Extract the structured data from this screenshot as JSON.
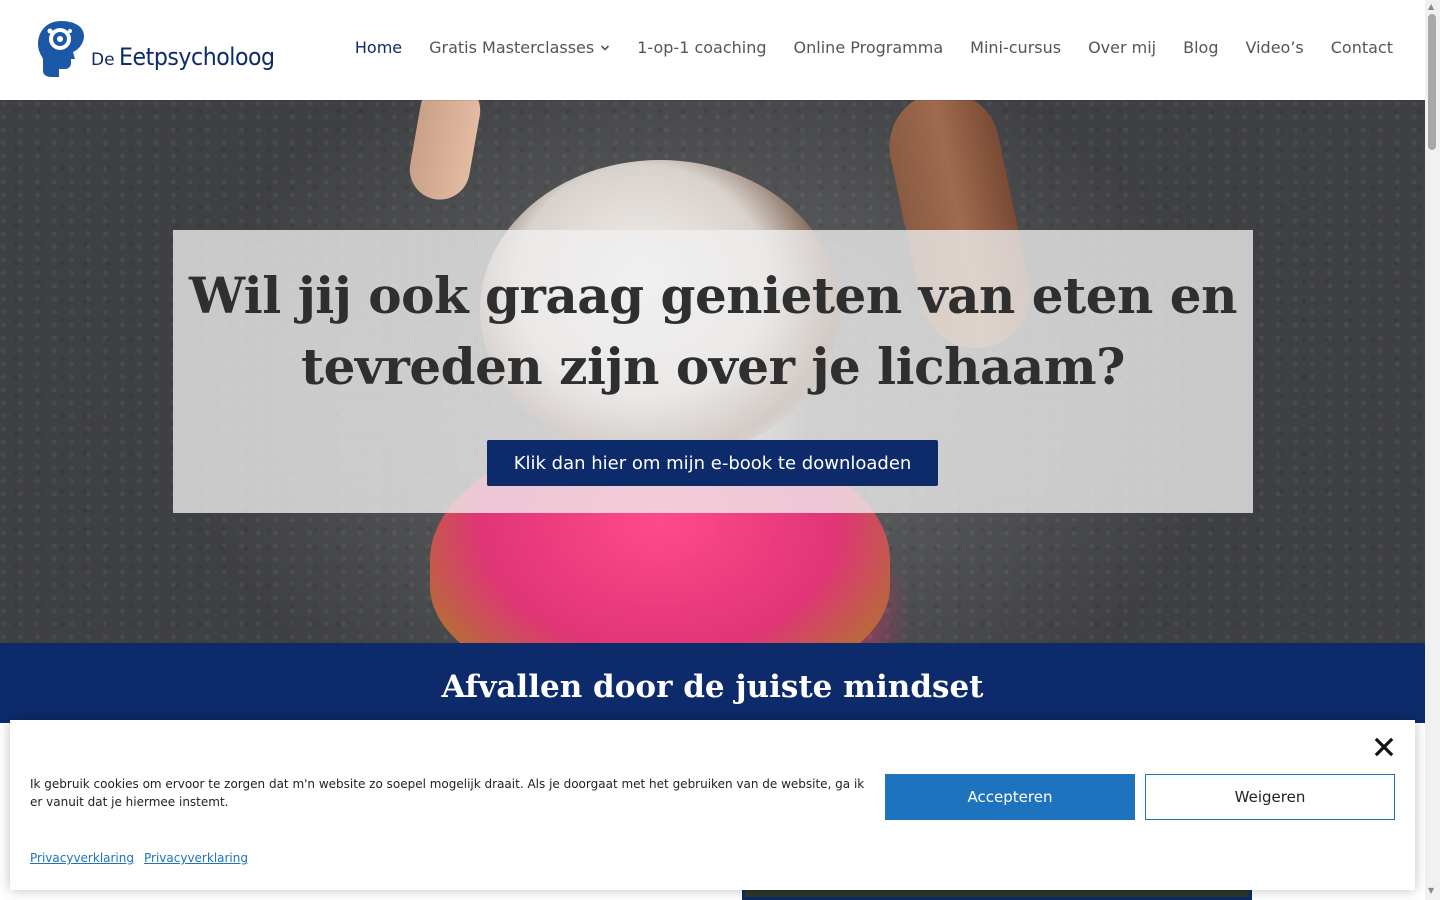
{
  "logo": {
    "prefix": "De",
    "name": "Eetpsycholoog",
    "icon": "head-with-brain-icon"
  },
  "nav": {
    "items": [
      {
        "label": "Home",
        "active": true
      },
      {
        "label": "Gratis Masterclasses",
        "dropdown": true
      },
      {
        "label": "1-op-1 coaching"
      },
      {
        "label": "Online Programma"
      },
      {
        "label": "Mini-cursus"
      },
      {
        "label": "Over mij"
      },
      {
        "label": "Blog"
      },
      {
        "label": "Video’s"
      },
      {
        "label": "Contact"
      }
    ]
  },
  "hero": {
    "title_line1": "Wil jij ook graag genieten van eten en",
    "title_line2": "tevreden zijn over je lichaam?",
    "cta_label": "Klik dan hier om mijn e-book te downloaden"
  },
  "band": {
    "title": "Afvallen door de juiste mindset"
  },
  "cookie": {
    "text": "Ik gebruik cookies om ervoor te zorgen dat m'n website zo soepel mogelijk draait. Als je doorgaat met het gebruiken van de website, ga ik er vanuit dat je hiermee instemt.",
    "accept_label": "Accepteren",
    "deny_label": "Weigeren",
    "links": [
      "Privacyverklaring",
      "Privacyverklaring"
    ]
  },
  "colors": {
    "brand_navy": "#0d2b6b",
    "accept_blue": "#1e73be"
  }
}
